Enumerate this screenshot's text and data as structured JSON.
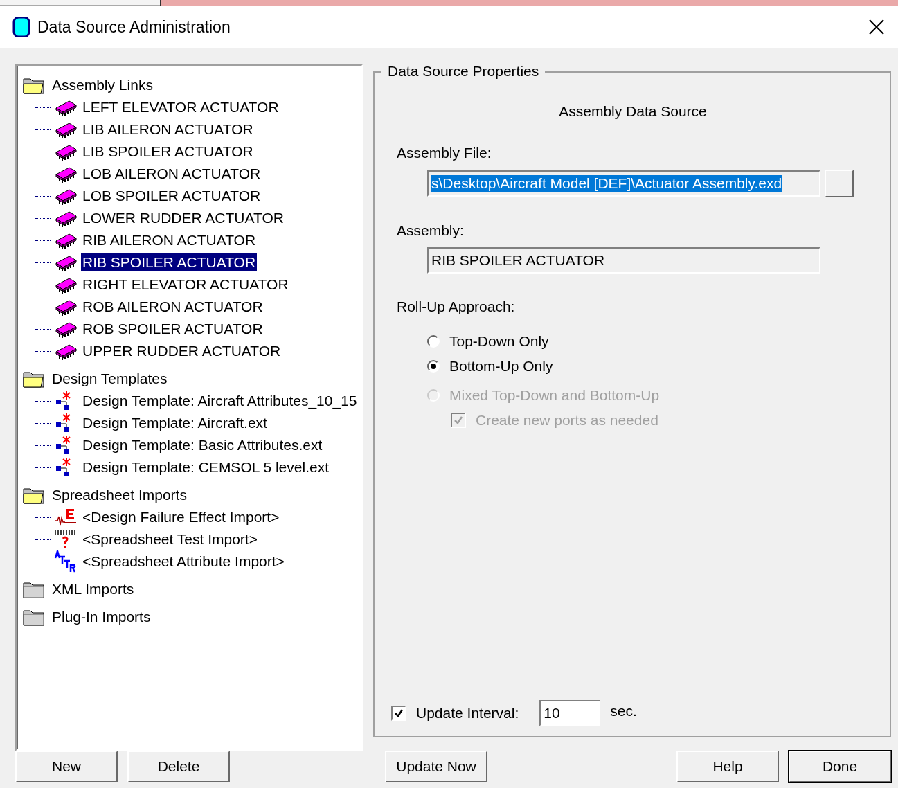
{
  "window": {
    "title": "Data Source Administration"
  },
  "tree": [
    {
      "label": "Assembly Links",
      "expanded": true,
      "children": [
        {
          "label": "LEFT ELEVATOR ACTUATOR",
          "kind": "assembly",
          "selected": false
        },
        {
          "label": "LIB AILERON ACTUATOR",
          "kind": "assembly",
          "selected": false
        },
        {
          "label": "LIB SPOILER ACTUATOR",
          "kind": "assembly",
          "selected": false
        },
        {
          "label": "LOB AILERON ACTUATOR",
          "kind": "assembly",
          "selected": false
        },
        {
          "label": "LOB SPOILER ACTUATOR",
          "kind": "assembly",
          "selected": false
        },
        {
          "label": "LOWER RUDDER ACTUATOR",
          "kind": "assembly",
          "selected": false
        },
        {
          "label": "RIB AILERON ACTUATOR",
          "kind": "assembly",
          "selected": false
        },
        {
          "label": "RIB SPOILER ACTUATOR",
          "kind": "assembly",
          "selected": true
        },
        {
          "label": "RIGHT ELEVATOR ACTUATOR",
          "kind": "assembly",
          "selected": false
        },
        {
          "label": "ROB AILERON ACTUATOR",
          "kind": "assembly",
          "selected": false
        },
        {
          "label": "ROB SPOILER ACTUATOR",
          "kind": "assembly",
          "selected": false
        },
        {
          "label": "UPPER RUDDER ACTUATOR",
          "kind": "assembly",
          "selected": false
        }
      ]
    },
    {
      "label": "Design Templates",
      "expanded": true,
      "children": [
        {
          "label": "Design Template: Aircraft Attributes_10_15",
          "kind": "template",
          "selected": false
        },
        {
          "label": "Design Template: Aircraft.ext",
          "kind": "template",
          "selected": false
        },
        {
          "label": "Design Template: Basic Attributes.ext",
          "kind": "template",
          "selected": false
        },
        {
          "label": "Design Template: CEMSOL 5 level.ext",
          "kind": "template",
          "selected": false
        }
      ]
    },
    {
      "label": "Spreadsheet Imports",
      "expanded": true,
      "children": [
        {
          "label": "<Design Failure Effect Import>",
          "kind": "failure",
          "selected": false
        },
        {
          "label": "<Spreadsheet Test Import>",
          "kind": "test",
          "selected": false
        },
        {
          "label": "<Spreadsheet Attribute Import>",
          "kind": "attribute",
          "selected": false
        }
      ]
    },
    {
      "label": "XML Imports",
      "expanded": false
    },
    {
      "label": "Plug-In Imports",
      "expanded": false
    }
  ],
  "properties": {
    "title": "Data Source Properties",
    "heading": "Assembly Data Source",
    "assembly_file": {
      "label": "Assembly File:",
      "value": "s\\Desktop\\Aircraft Model [DEF]\\Actuator Assembly.exd"
    },
    "assembly": {
      "label": "Assembly:",
      "value": "RIB SPOILER ACTUATOR"
    },
    "rollup": {
      "label": "Roll-Up Approach:",
      "options": [
        {
          "label": "Top-Down Only",
          "selected": false,
          "disabled": false
        },
        {
          "label": "Bottom-Up Only",
          "selected": true,
          "disabled": false
        },
        {
          "label": "Mixed Top-Down and Bottom-Up",
          "selected": false,
          "disabled": true
        }
      ],
      "create_ports": {
        "label": "Create new ports as needed",
        "checked": true,
        "disabled": true
      }
    },
    "update_interval": {
      "label": "Update Interval:",
      "checked": true,
      "value": "10",
      "unit": "sec."
    }
  },
  "buttons": {
    "left": [
      "New",
      "Delete"
    ],
    "middle": [
      "Update Now"
    ],
    "right": [
      "Help",
      "Done"
    ]
  }
}
